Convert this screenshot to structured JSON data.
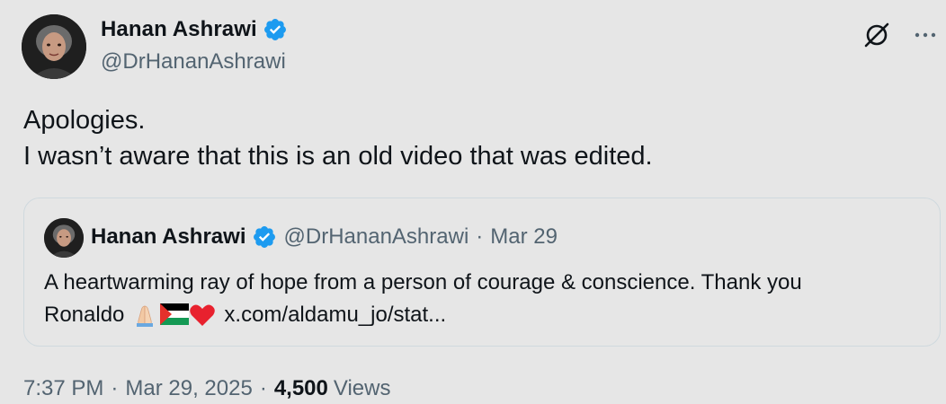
{
  "author": {
    "name": "Hanan Ashrawi",
    "handle": "@DrHananAshrawi",
    "verified": true
  },
  "tweet": {
    "lines": [
      "Apologies.",
      "I wasn’t aware that this is an old video that was edited."
    ]
  },
  "quote": {
    "name": "Hanan Ashrawi",
    "handle": "@DrHananAshrawi",
    "separator": "·",
    "date": "Mar 29",
    "line1": "A heartwarming ray of hope from a person of courage & conscience. Thank you",
    "line2_text": "Ronaldo",
    "emojis": [
      "folded-hands",
      "palestine-flag",
      "red-heart"
    ],
    "link": "x.com/aldamu_jo/stat..."
  },
  "meta": {
    "time": "7:37 PM",
    "separator": "·",
    "date": "Mar 29, 2025",
    "views_count": "4,500",
    "views_label": "Views"
  },
  "icons": {
    "grok": "grok-icon",
    "more": "more-icon",
    "verified": "verified-badge-icon"
  },
  "colors": {
    "background": "#e6e6e6",
    "text_primary": "#0f1419",
    "text_secondary": "#536471",
    "verified_blue": "#1d9bf0",
    "border": "#cfd9de"
  }
}
